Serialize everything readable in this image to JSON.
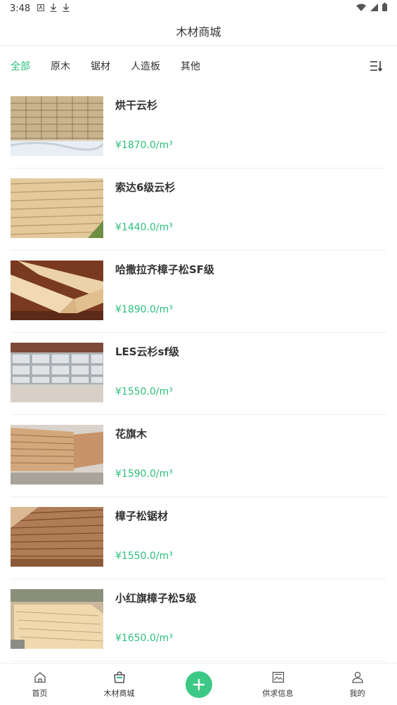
{
  "status_bar": {
    "time": "3:48"
  },
  "header": {
    "title": "木材商城"
  },
  "tabs": [
    {
      "label": "全部"
    },
    {
      "label": "原木"
    },
    {
      "label": "锯材"
    },
    {
      "label": "人造板"
    },
    {
      "label": "其他"
    }
  ],
  "products": [
    {
      "name": "烘干云杉",
      "price": "¥1870.0/m³"
    },
    {
      "name": "索达6级云杉",
      "price": "¥1440.0/m³"
    },
    {
      "name": "哈撒拉齐樟子松SF级",
      "price": "¥1890.0/m³"
    },
    {
      "name": "LES云杉sf级",
      "price": "¥1550.0/m³"
    },
    {
      "name": "花旗木",
      "price": "¥1590.0/m³"
    },
    {
      "name": "樟子松锯材",
      "price": "¥1550.0/m³"
    },
    {
      "name": "小红旗樟子松5级",
      "price": "¥1650.0/m³"
    }
  ],
  "bottom_nav": {
    "home": "首页",
    "mall": "木材商城",
    "supply": "供求信息",
    "mine": "我的"
  },
  "colors": {
    "accent": "#2dbf7c",
    "plus_button": "#3cc985"
  }
}
